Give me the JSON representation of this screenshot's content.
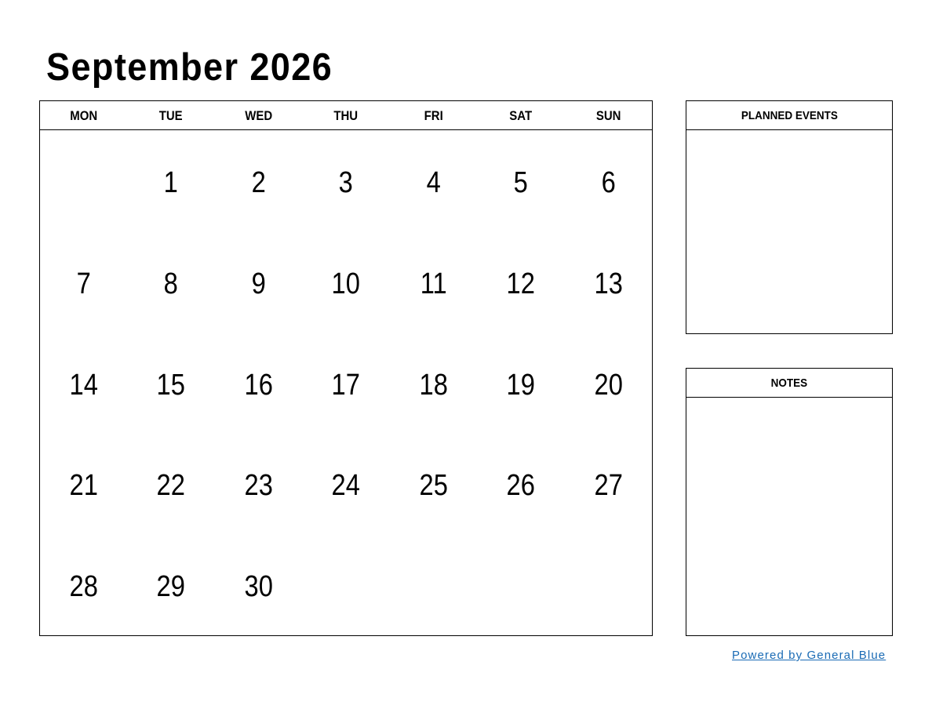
{
  "calendar": {
    "title": "September 2026",
    "weekdays": [
      "MON",
      "TUE",
      "WED",
      "THU",
      "FRI",
      "SAT",
      "SUN"
    ],
    "weeks": [
      [
        "",
        "1",
        "2",
        "3",
        "4",
        "5",
        "6"
      ],
      [
        "7",
        "8",
        "9",
        "10",
        "11",
        "12",
        "13"
      ],
      [
        "14",
        "15",
        "16",
        "17",
        "18",
        "19",
        "20"
      ],
      [
        "21",
        "22",
        "23",
        "24",
        "25",
        "26",
        "27"
      ],
      [
        "28",
        "29",
        "30",
        "",
        "",
        "",
        ""
      ]
    ]
  },
  "side_panels": {
    "planned_events": {
      "label": "PLANNED EVENTS"
    },
    "notes": {
      "label": "NOTES"
    }
  },
  "footer": {
    "link_text": "Powered by General Blue",
    "link_color": "#1a6bb5"
  }
}
